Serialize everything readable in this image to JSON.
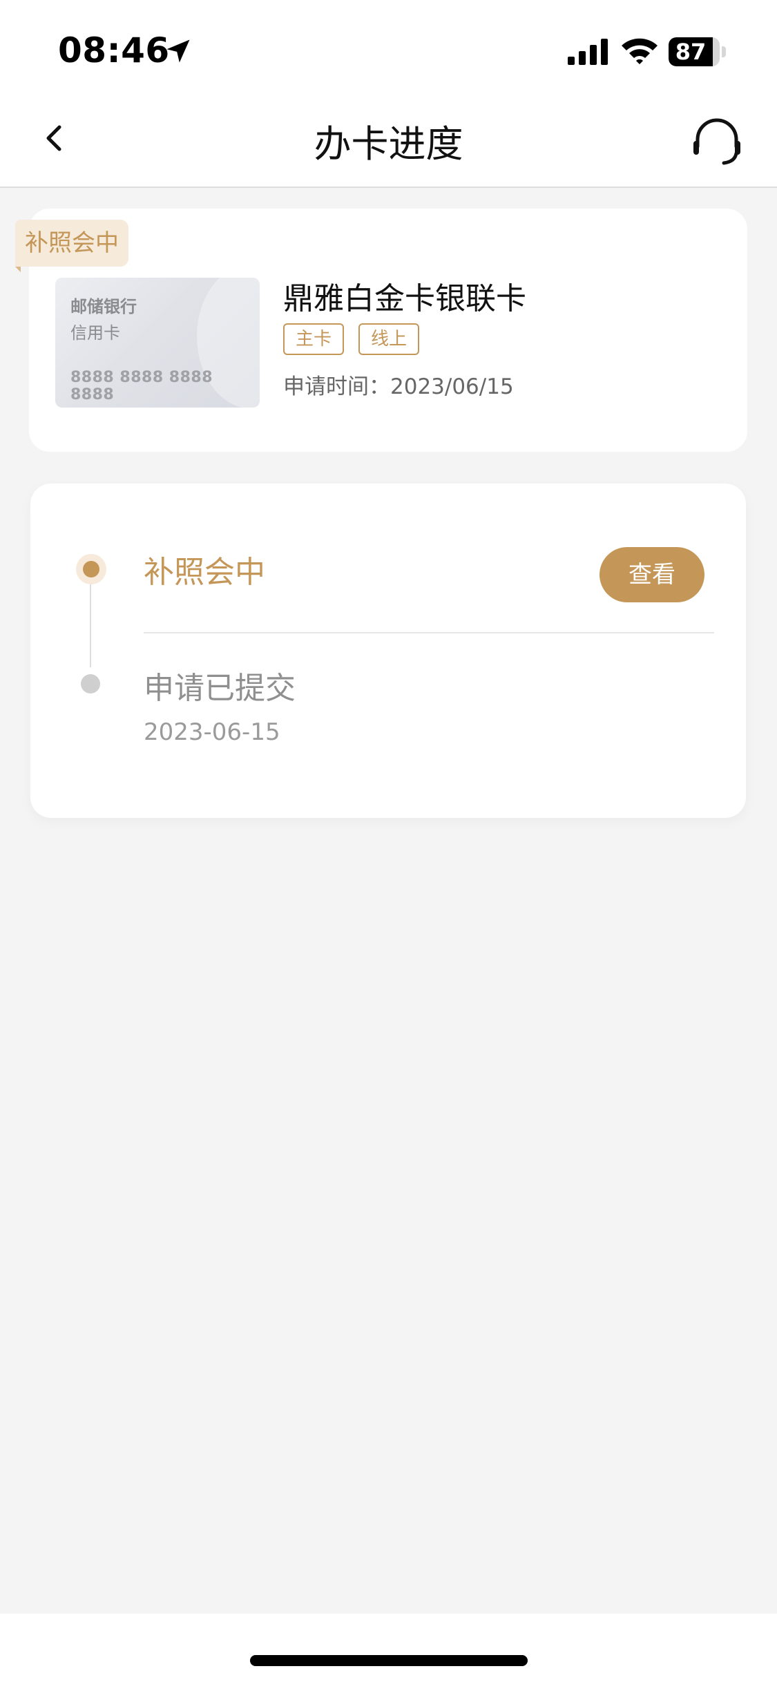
{
  "status_bar": {
    "time": "08:46",
    "battery": "87",
    "battery_level": 0.87
  },
  "nav": {
    "title": "办卡进度"
  },
  "card": {
    "status_tag": "补照会中",
    "bank_name": "邮储银行",
    "card_type": "信用卡",
    "card_number": "8888 8888 8888 8888",
    "product_name": "鼎雅白金卡银联卡",
    "tags": [
      "主卡",
      "线上"
    ],
    "apply_time": "申请时间：2023/06/15"
  },
  "progress": {
    "current_step": "补照会中",
    "view_label": "查看",
    "submitted_step": "申请已提交",
    "submitted_date": "2023-06-15"
  },
  "colors": {
    "accent": "#c49658",
    "accent_light": "#f6eadb",
    "background": "#f4f4f5"
  }
}
